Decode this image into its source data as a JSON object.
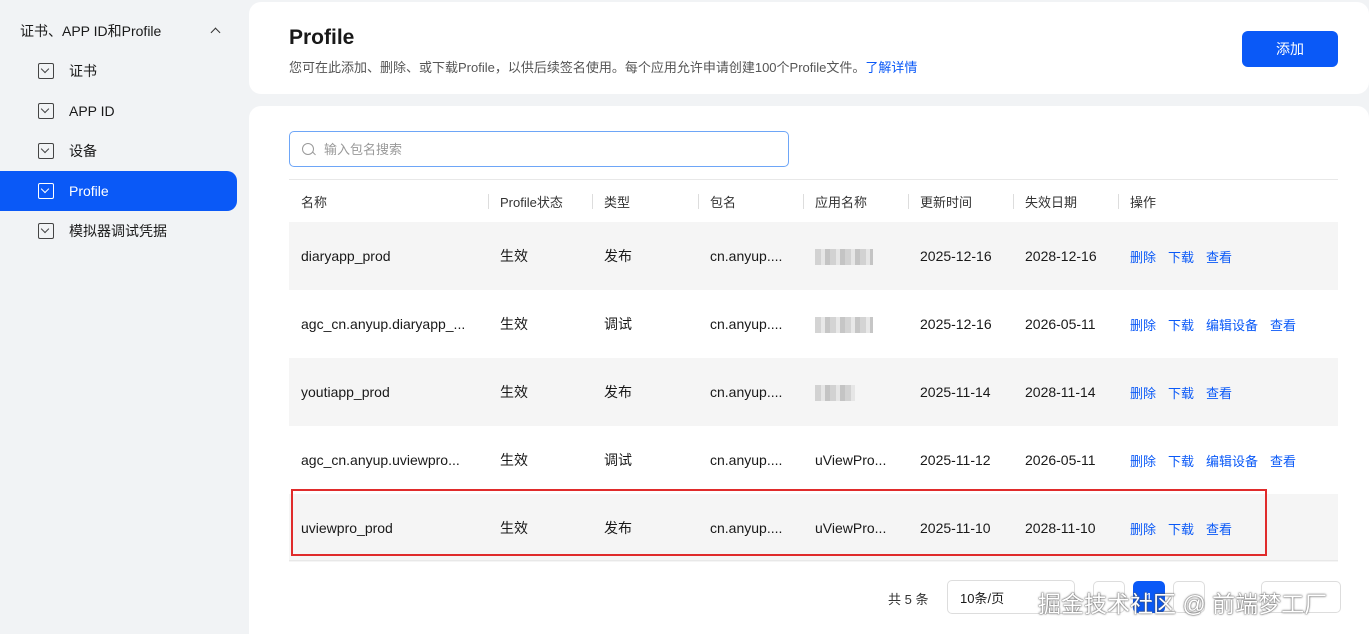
{
  "sidebar": {
    "group_label": "证书、APP ID和Profile",
    "items": [
      {
        "label": "证书",
        "active": false
      },
      {
        "label": "APP ID",
        "active": false
      },
      {
        "label": "设备",
        "active": false
      },
      {
        "label": "Profile",
        "active": true
      },
      {
        "label": "模拟器调试凭据",
        "active": false
      }
    ]
  },
  "header": {
    "title": "Profile",
    "description": "您可在此添加、删除、或下载Profile，以供后续签名使用。每个应用允许申请创建100个Profile文件。",
    "learn_more": "了解详情",
    "add_button": "添加"
  },
  "search": {
    "placeholder": "输入包名搜索"
  },
  "table": {
    "columns": [
      "名称",
      "Profile状态",
      "类型",
      "包名",
      "应用名称",
      "更新时间",
      "失效日期",
      "操作"
    ],
    "rows": [
      {
        "name": "diaryapp_prod",
        "status": "生效",
        "type": "发布",
        "package": "cn.anyup....",
        "app_name": "",
        "updated": "2025-12-16",
        "expires": "2028-12-16",
        "actions": [
          "删除",
          "下载",
          "查看"
        ]
      },
      {
        "name": "agc_cn.anyup.diaryapp_...",
        "status": "生效",
        "type": "调试",
        "package": "cn.anyup....",
        "app_name": "",
        "updated": "2025-12-16",
        "expires": "2026-05-11",
        "actions": [
          "删除",
          "下载",
          "编辑设备",
          "查看"
        ]
      },
      {
        "name": "youtiapp_prod",
        "status": "生效",
        "type": "发布",
        "package": "cn.anyup....",
        "app_name": "",
        "updated": "2025-11-14",
        "expires": "2028-11-14",
        "actions": [
          "删除",
          "下载",
          "查看"
        ]
      },
      {
        "name": "agc_cn.anyup.uviewpro...",
        "status": "生效",
        "type": "调试",
        "package": "cn.anyup....",
        "app_name": "uViewPro...",
        "updated": "2025-11-12",
        "expires": "2026-05-11",
        "actions": [
          "删除",
          "下载",
          "编辑设备",
          "查看"
        ]
      },
      {
        "name": "uviewpro_prod",
        "status": "生效",
        "type": "发布",
        "package": "cn.anyup....",
        "app_name": "uViewPro...",
        "updated": "2025-11-10",
        "expires": "2028-11-10",
        "actions": [
          "删除",
          "下载",
          "查看"
        ]
      }
    ]
  },
  "pagination": {
    "total": "共 5 条",
    "page_size": "10条/页",
    "current_page": "1"
  },
  "watermark": "掘金技术社区 @ 前端梦工厂"
}
